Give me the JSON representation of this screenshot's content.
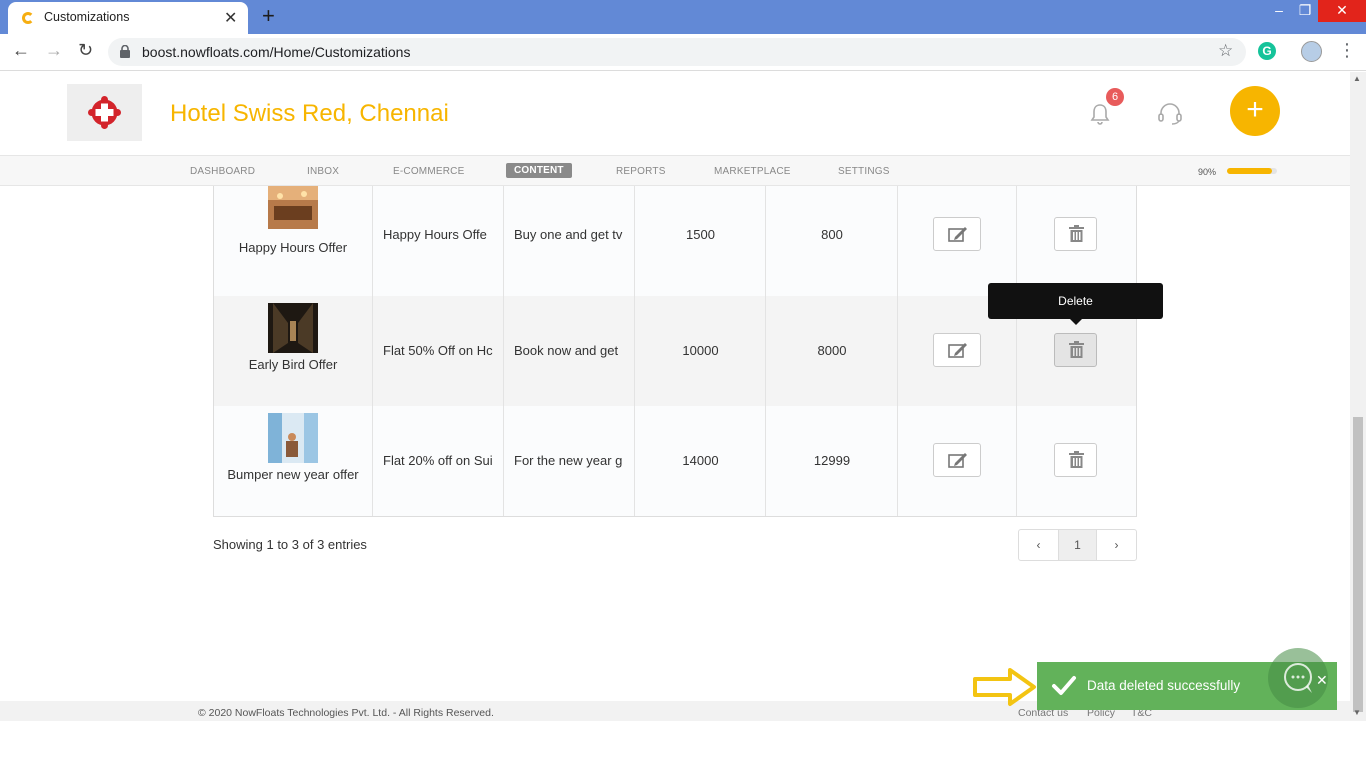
{
  "browser": {
    "tab_title": "Customizations",
    "tab_close": "✕",
    "new_tab": "+",
    "url": "boost.nowfloats.com/Home/Customizations",
    "window_minimize": "–",
    "window_restore": "❐",
    "window_close": "✕"
  },
  "header": {
    "business_name": "Hotel Swiss Red, Chennai",
    "notification_count": "6",
    "add_label": "+"
  },
  "nav": {
    "items": [
      "DASHBOARD",
      "INBOX",
      "E-COMMERCE",
      "CONTENT",
      "REPORTS",
      "MARKETPLACE",
      "SETTINGS"
    ],
    "active": "CONTENT",
    "progress_label": "90%",
    "progress_value": 0.9
  },
  "table": {
    "rows": [
      {
        "name": "Happy Hours Offer",
        "title": "Happy Hours Offe",
        "description": "Buy one and get tv",
        "price": "1500",
        "discount_price": "800"
      },
      {
        "name": "Early Bird Offer",
        "title": "Flat 50% Off on Hc",
        "description": "Book now and get",
        "price": "10000",
        "discount_price": "8000"
      },
      {
        "name": "Bumper new year offer",
        "title": "Flat 20% off on Sui",
        "description": "For the new year g",
        "price": "14000",
        "discount_price": "12999"
      }
    ]
  },
  "tooltip": {
    "text": "Delete"
  },
  "pagination": {
    "showing": "Showing 1 to 3 of 3 entries",
    "prev": "‹",
    "page": "1",
    "next": "›"
  },
  "footer": {
    "copyright": "© 2020 NowFloats Technologies Pvt. Ltd. - All Rights Reserved.",
    "links": [
      "Contact us",
      "Policy",
      "T&C"
    ]
  },
  "toast": {
    "message": "Data deleted successfully",
    "close": "✕"
  },
  "colors": {
    "brand": "#f7b500",
    "chrome_blue": "#6289d6",
    "toast_green": "#62b25a",
    "badge_red": "#e85b5b"
  }
}
